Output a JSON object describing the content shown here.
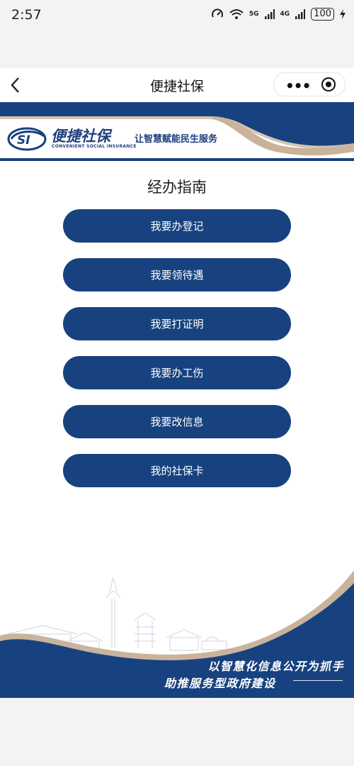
{
  "status_bar": {
    "time": "2:57",
    "network_5g": "5G",
    "network_4g": "4G",
    "battery": "100"
  },
  "nav": {
    "title": "便捷社保"
  },
  "banner": {
    "logo_mark": "SI",
    "logo_title": "便捷社保",
    "logo_subtitle": "CONVENIENT SOCIAL INSURANCE",
    "slogan": "让智慧赋能民生服务"
  },
  "guide": {
    "title": "经办指南",
    "buttons": [
      {
        "label": "我要办登记"
      },
      {
        "label": "我要领待遇"
      },
      {
        "label": "我要打证明"
      },
      {
        "label": "我要办工伤"
      },
      {
        "label": "我要改信息"
      },
      {
        "label": "我的社保卡"
      }
    ]
  },
  "footer": {
    "line1": "以智慧化信息公开为抓手",
    "line2": "助推服务型政府建设"
  },
  "colors": {
    "primary": "#17427f",
    "accent": "#c9b39b"
  }
}
